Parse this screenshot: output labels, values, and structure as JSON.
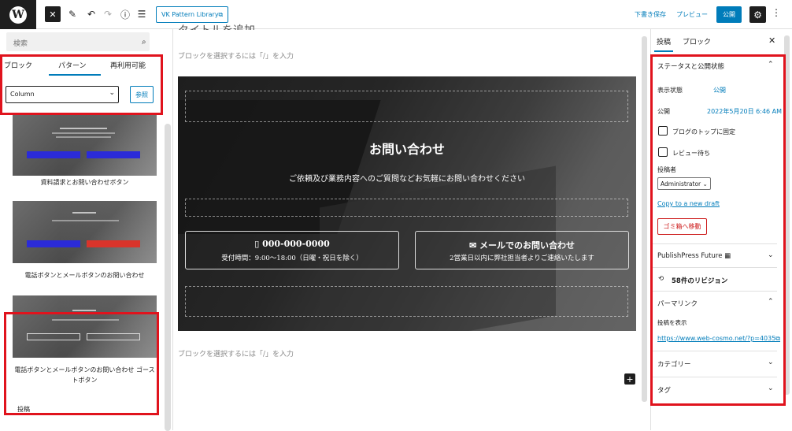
{
  "topbar": {
    "pattern_library_label": "VK Pattern Library⧉",
    "save_draft": "下書き保存",
    "preview": "プレビュー",
    "publish": "公開",
    "icons": [
      "wordpress-icon",
      "close-icon",
      "pencil-icon",
      "undo-icon",
      "redo-icon",
      "info-icon",
      "list-view-icon",
      "gear-icon",
      "more-vertical-icon"
    ]
  },
  "inserter": {
    "search_placeholder": "検索",
    "tabs": [
      "ブロック",
      "パターン",
      "再利用可能"
    ],
    "active_tab": "パターン",
    "category_value": "Column",
    "browse_label": "参照",
    "patterns": [
      {
        "label": "資料請求とお問い合わせボタン"
      },
      {
        "label": "電話ボタンとメールボタンのお問い合わせ"
      },
      {
        "label": "電話ボタンとメールボタンのお問い合わせ ゴーストボタン"
      }
    ],
    "bottom_status": "投稿"
  },
  "canvas": {
    "title_partial": "タイトルを追加",
    "block_placeholder": "ブロックを選択するには「/」を入力",
    "cover": {
      "title": "お問い合わせ",
      "subtitle": "ご依頼及び業務内容へのご質問などお気軽にお問い合わせください",
      "phone_button": {
        "line1": "▯ 000-000-0000",
        "line2": "受付時間：9:00〜18:00（日曜・祝日を除く）"
      },
      "mail_button": {
        "line1": "✉ メールでのお問い合わせ",
        "line2": "2営業日以内に弊社担当者よりご連絡いたします"
      }
    },
    "add_block": "+"
  },
  "sidebar": {
    "tabs": [
      "投稿",
      "ブロック"
    ],
    "status_section": "ステータスと公開状態",
    "visibility_label": "表示状態",
    "visibility_value": "公開",
    "publish_label": "公開",
    "publish_value": "2022年5月20日 6:46 AM",
    "stick_to_top": "ブログのトップに固定",
    "pending_review": "レビュー待ち",
    "author_label": "投稿者",
    "author_value": "Administrator ⌄",
    "copy_draft": "Copy to a new draft",
    "trash": "ゴミ箱へ移動",
    "publishpress": "PublishPress Future ▦",
    "revisions": "58件のリビジョン",
    "permalink_section": "パーマリンク",
    "view_post": "投稿を表示",
    "permalink_url": "https://www.web-cosmo.net/?p=4035⧉",
    "categories": "カテゴリー",
    "tags": "タグ"
  },
  "colors": {
    "accent": "#007cba",
    "annotation": "#e0131d",
    "danger": "#cc1818"
  }
}
